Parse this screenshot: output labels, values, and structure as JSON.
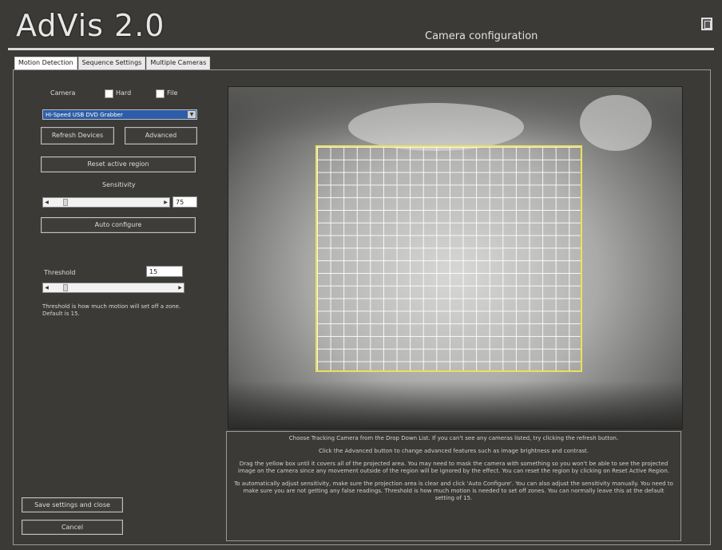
{
  "app": {
    "title": "AdVis 2.0",
    "subtitle": "Camera configuration"
  },
  "tabs": [
    {
      "label": "Motion Detection",
      "active": true
    },
    {
      "label": "Sequence Settings",
      "active": false
    },
    {
      "label": "Multiple Cameras",
      "active": false
    }
  ],
  "controls": {
    "camera_label": "Camera",
    "source_options": [
      "Hard",
      "File"
    ],
    "device_value": "Hi-Speed USB DVD Grabber",
    "refresh_label": "Refresh Devices",
    "advanced_label": "Advanced",
    "reset_label": "Reset active region",
    "sensitivity_label": "Sensitivity",
    "sensitivity_value": "75",
    "autoconfig_label": "Auto configure",
    "threshold_label": "Threshold",
    "threshold_value": "15",
    "threshold_note": "Threshold is how much motion will set off a zone. Default is 15."
  },
  "footer": {
    "save_label": "Save settings and close",
    "cancel_label": "Cancel"
  },
  "help": [
    "Choose Tracking Camera from the Drop Down List. If you can't see any cameras listed, try clicking the refresh button.",
    "Click the Advanced button to change advanced features such as image brightness and contrast.",
    "Drag the yellow box until it covers all of the projected area. You may need to mask the camera with something so you won't be able to see the projected image on the camera since any movement outside of the region will be ignored by the effect. You can reset the region by clicking on Reset Active Region.",
    "To automatically adjust sensitivity, make sure the projection area is clear and click 'Auto Configure'. You can also adjust the sensitivity manually. You need to make sure you are not getting any false readings. Threshold is how much motion is needed to set off zones. You can normally leave this at the default setting of 15."
  ],
  "colors": {
    "background": "#3b3a37",
    "selection": "#2d5da8",
    "region": "#e9e25a"
  },
  "icons": {
    "window": "restore-icon"
  }
}
